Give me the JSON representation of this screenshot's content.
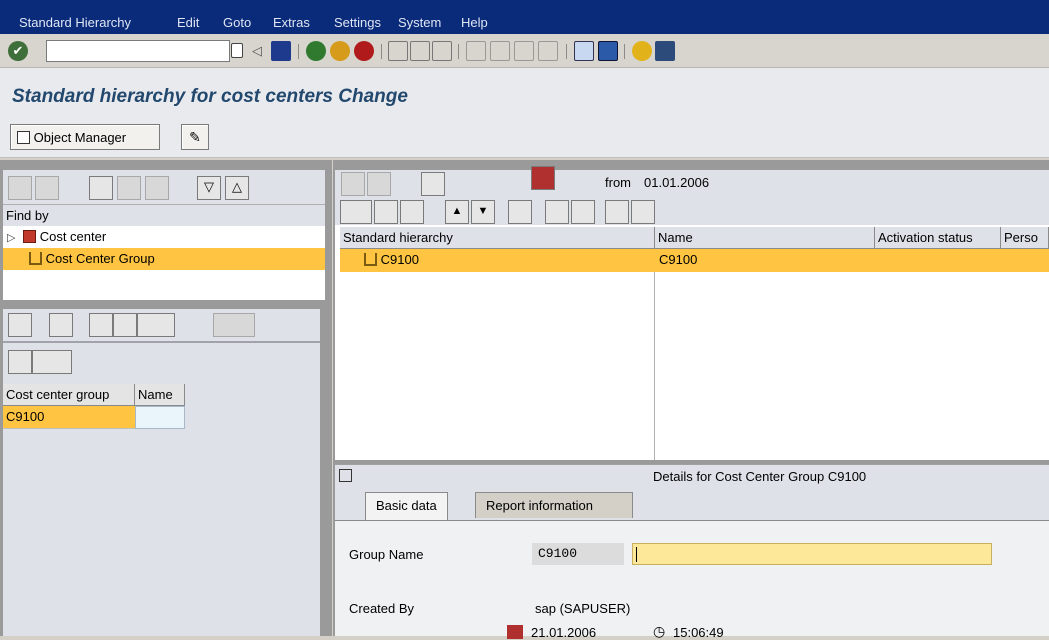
{
  "menubar": {
    "items": [
      "Standard Hierarchy",
      "Edit",
      "Goto",
      "Extras",
      "Settings",
      "System",
      "Help"
    ]
  },
  "title": "Standard hierarchy for cost centers Change",
  "appbar": {
    "object_manager_label": "Object Manager"
  },
  "findby": {
    "label": "Find by",
    "items": [
      "Cost center",
      "Cost Center Group"
    ]
  },
  "result_table": {
    "headers": [
      "Cost center group",
      "Name"
    ],
    "rows": [
      [
        "C9100",
        ""
      ]
    ]
  },
  "hierarchy": {
    "from_label": "from",
    "from_date": "01.01.2006",
    "headers": [
      "Standard hierarchy",
      "Name",
      "Activation status",
      "Perso"
    ],
    "rows": [
      [
        "C9100",
        "C9100"
      ]
    ]
  },
  "details": {
    "title": "Details for Cost Center Group C9100",
    "tabs": [
      "Basic data",
      "Report information"
    ],
    "group_name_label": "Group Name",
    "group_name_value": "C9100",
    "created_by_label": "Created By",
    "created_by_value": "sap (SAPUSER)",
    "created_date": "21.01.2006",
    "created_time": "15:06:49"
  },
  "colors": {
    "menubar": "#0a2a7a",
    "selection": "#ffc542",
    "title": "#23486e",
    "panel": "#dee2e8"
  }
}
